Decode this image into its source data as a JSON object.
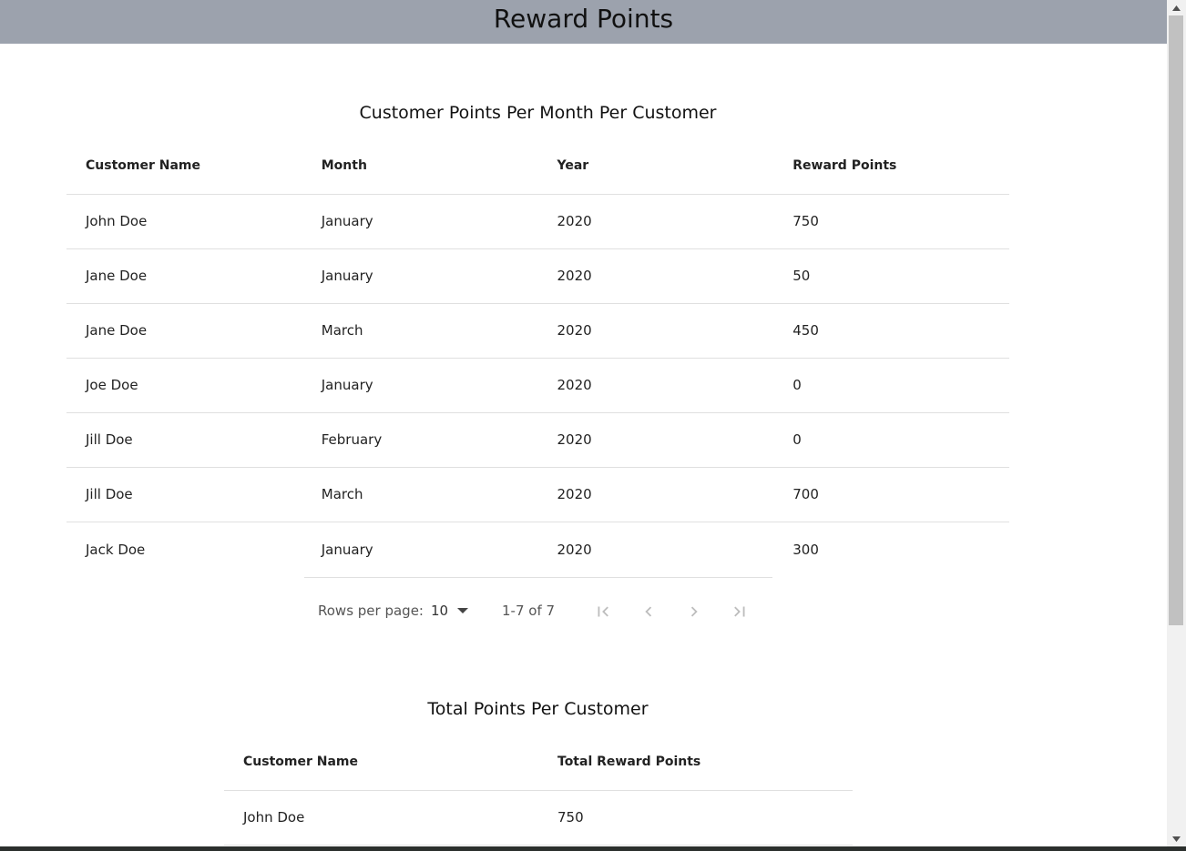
{
  "header": {
    "title": "Reward Points"
  },
  "monthly": {
    "title": "Customer Points Per Month Per Customer",
    "columns": [
      "Customer Name",
      "Month",
      "Year",
      "Reward Points"
    ],
    "rows": [
      [
        "John Doe",
        "January",
        "2020",
        "750"
      ],
      [
        "Jane Doe",
        "January",
        "2020",
        "50"
      ],
      [
        "Jane Doe",
        "March",
        "2020",
        "450"
      ],
      [
        "Joe Doe",
        "January",
        "2020",
        "0"
      ],
      [
        "Jill Doe",
        "February",
        "2020",
        "0"
      ],
      [
        "Jill Doe",
        "March",
        "2020",
        "700"
      ],
      [
        "Jack Doe",
        "January",
        "2020",
        "300"
      ]
    ],
    "pagination": {
      "rows_per_page_label": "Rows per page:",
      "rows_per_page_value": "10",
      "range_label": "1-7 of 7"
    }
  },
  "totals": {
    "title": "Total Points Per Customer",
    "columns": [
      "Customer Name",
      "Total Reward Points"
    ],
    "rows": [
      [
        "John Doe",
        "750"
      ]
    ]
  },
  "icons": {
    "first_page": "first-page-icon",
    "prev_page": "chevron-left-icon",
    "next_page": "chevron-right-icon",
    "last_page": "last-page-icon",
    "dropdown": "caret-down-icon"
  },
  "colors": {
    "header_bg": "#9ca2ad",
    "disabled_icon": "#bdbdbd"
  }
}
